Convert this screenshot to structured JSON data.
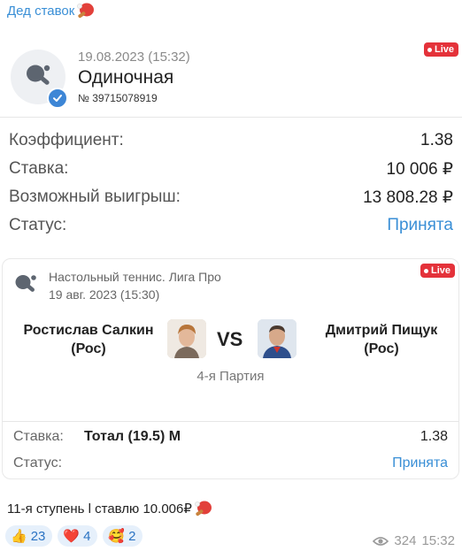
{
  "channel": {
    "name": "Дед ставок"
  },
  "ticket": {
    "datetime": "19.08.2023 (15:32)",
    "type": "Одиночная",
    "number": "№ 39715078919",
    "live_label": "Live",
    "rows": [
      {
        "label": "Коэффициент:",
        "value": "1.38"
      },
      {
        "label": "Ставка:",
        "value": "10 006 ₽"
      },
      {
        "label": "Возможный выигрыш:",
        "value": "13 808.28 ₽"
      },
      {
        "label": "Статус:",
        "value": "Принята"
      }
    ]
  },
  "event": {
    "league": "Настольный теннис. Лига Про",
    "datetime": "19 авг. 2023 (15:30)",
    "live_label": "Live",
    "player1": {
      "name": "Ростислав Салкин",
      "country": "(Рос)"
    },
    "vs": "VS",
    "player2": {
      "name": "Дмитрий Пищук",
      "country": "(Рос)"
    },
    "set": "4-я Партия",
    "bet": {
      "label": "Ставка:",
      "market": "Тотал (19.5) М",
      "odds": "1.38"
    },
    "status": {
      "label": "Статус:",
      "value": "Принята"
    }
  },
  "caption": "11-я ступень l ставлю 10.006₽",
  "reactions": [
    {
      "emoji": "👍",
      "count": "23"
    },
    {
      "emoji": "❤️",
      "count": "4"
    },
    {
      "emoji": "🥰",
      "count": "2"
    }
  ],
  "meta": {
    "views": "324",
    "time": "15:32"
  },
  "colors": {
    "accent": "#3a8fd6",
    "live": "#e4323a",
    "reaction_bg": "#e6f0fb"
  }
}
